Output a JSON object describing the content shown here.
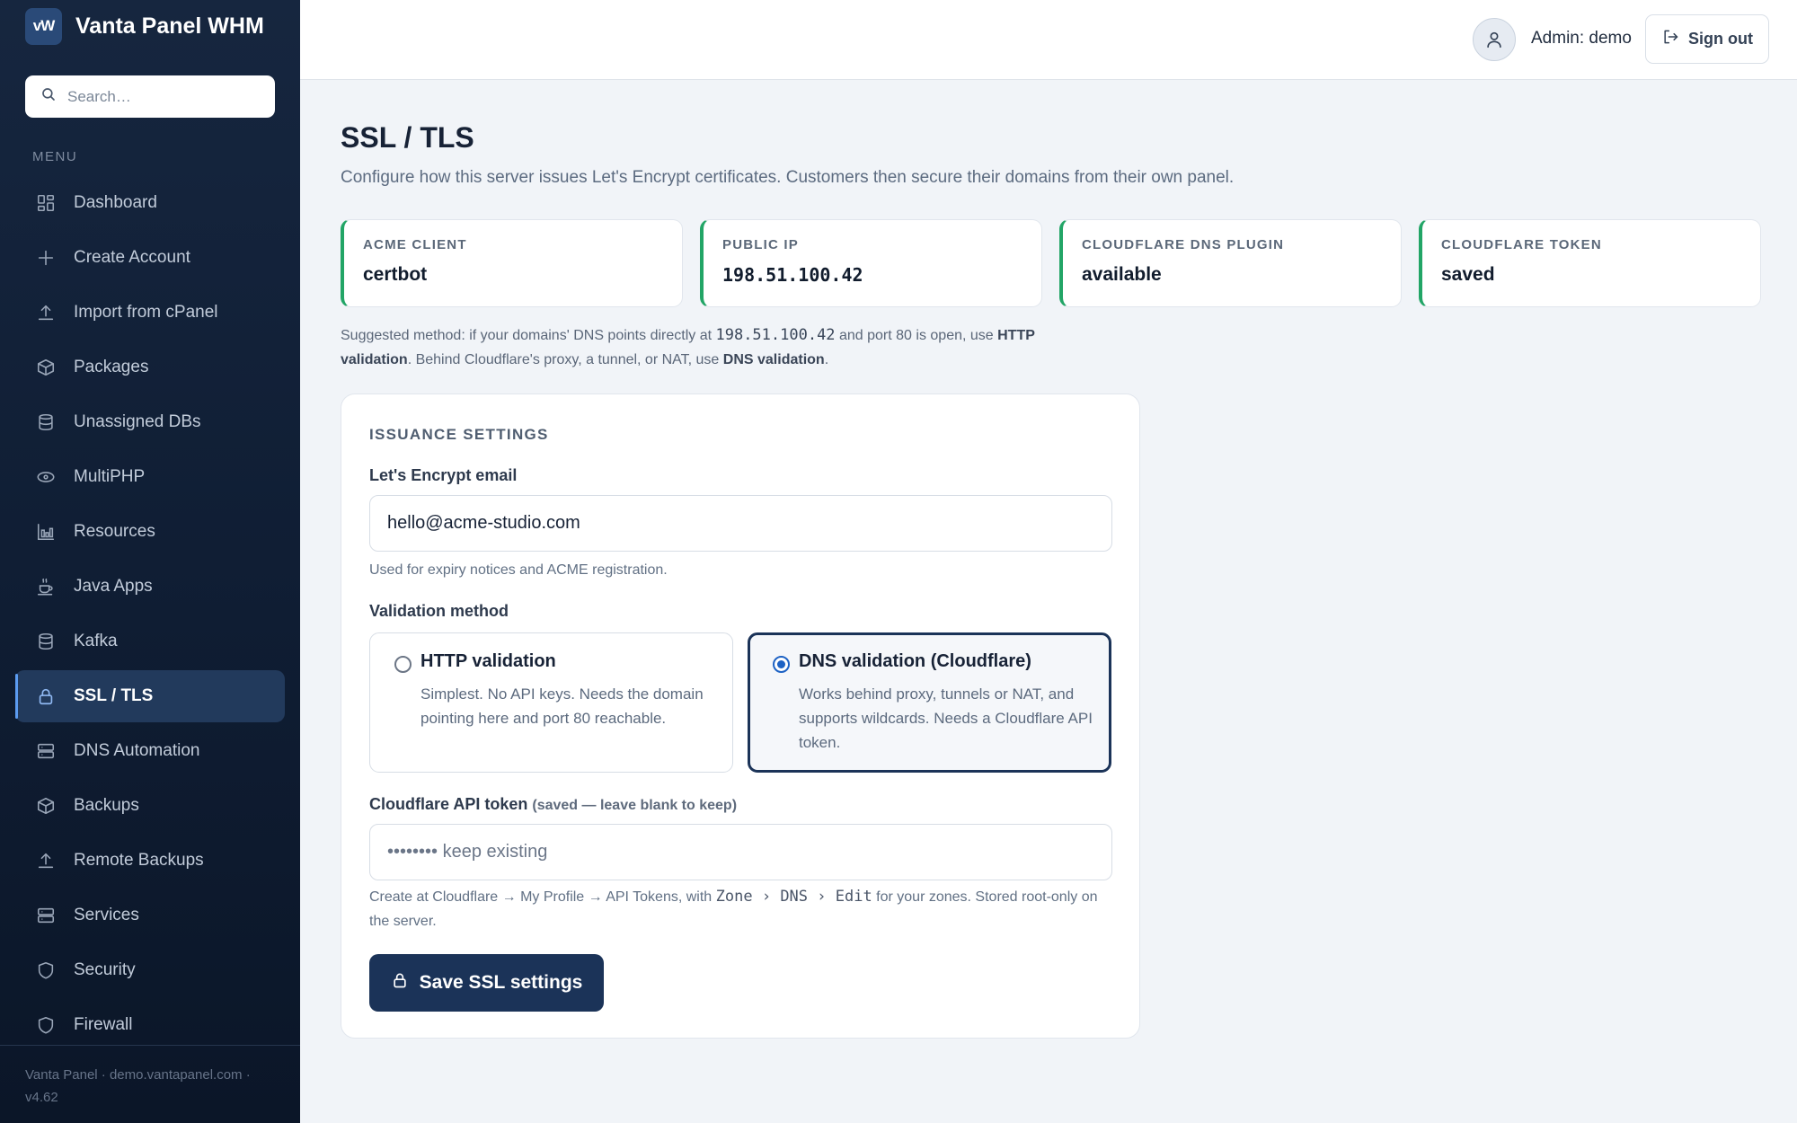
{
  "app": {
    "logo_text": "vW",
    "name": "Vanta Panel WHM"
  },
  "sidebar": {
    "search_placeholder": "Search…",
    "menu_heading": "MENU",
    "items": [
      {
        "label": "Dashboard",
        "icon": "dashboard-icon"
      },
      {
        "label": "Create Account",
        "icon": "plus-icon"
      },
      {
        "label": "Import from cPanel",
        "icon": "upload-icon"
      },
      {
        "label": "Packages",
        "icon": "box-icon"
      },
      {
        "label": "Unassigned DBs",
        "icon": "database-icon"
      },
      {
        "label": "MultiPHP",
        "icon": "php-icon"
      },
      {
        "label": "Resources",
        "icon": "bar-chart-icon"
      },
      {
        "label": "Java Apps",
        "icon": "coffee-icon"
      },
      {
        "label": "Kafka",
        "icon": "database-icon"
      },
      {
        "label": "SSL / TLS",
        "icon": "lock-icon",
        "active": true
      },
      {
        "label": "DNS Automation",
        "icon": "server-icon"
      },
      {
        "label": "Backups",
        "icon": "box-icon"
      },
      {
        "label": "Remote Backups",
        "icon": "upload-icon"
      },
      {
        "label": "Services",
        "icon": "server-icon"
      },
      {
        "label": "Security",
        "icon": "shield-icon"
      },
      {
        "label": "Firewall",
        "icon": "shield-icon"
      }
    ],
    "footer": "Vanta Panel · demo.vantapanel.com · v4.62"
  },
  "header": {
    "admin_label": "Admin: demo",
    "sign_out": "Sign out"
  },
  "page": {
    "title": "SSL / TLS",
    "subtitle": "Configure how this server issues Let's Encrypt certificates. Customers then secure their domains from their own panel.",
    "stats": [
      {
        "label": "ACME CLIENT",
        "value": "certbot"
      },
      {
        "label": "PUBLIC IP",
        "value": "198.51.100.42"
      },
      {
        "label": "CLOUDFLARE DNS PLUGIN",
        "value": "available"
      },
      {
        "label": "CLOUDFLARE TOKEN",
        "value": "saved"
      }
    ],
    "note": {
      "p1": "Suggested method: if your domains' DNS points directly at ",
      "ip": "198.51.100.42",
      "p2": " and port 80 is open, use ",
      "http_bold": "HTTP validation",
      "p3": ". Behind Cloudflare's proxy, a tunnel, or NAT, use ",
      "dns_bold": "DNS validation",
      "p4": "."
    }
  },
  "settings": {
    "title": "ISSUANCE SETTINGS",
    "email_label": "Let's Encrypt email",
    "email_value": "hello@acme-studio.com",
    "email_help": "Used for expiry notices and ACME registration.",
    "method_label": "Validation method",
    "methods": [
      {
        "title": "HTTP validation",
        "desc": "Simplest. No API keys. Needs the domain pointing here and port 80 reachable.",
        "selected": false
      },
      {
        "title": "DNS validation (Cloudflare)",
        "desc": "Works behind proxy, tunnels or NAT, and supports wildcards. Needs a Cloudflare API token.",
        "selected": true
      }
    ],
    "token_label": "Cloudflare API token",
    "token_hint": "(saved — leave blank to keep)",
    "token_placeholder": "•••••••• keep existing",
    "token_help": {
      "p1": "Create at Cloudflare → My Profile → API Tokens, with ",
      "perm1": "Zone",
      "sep1": " › ",
      "perm2": "DNS",
      "sep2": " › ",
      "perm3": "Edit",
      "p2": " for your zones. Stored root-only on the server."
    },
    "save_label": "Save SSL settings"
  },
  "colors": {
    "sidebar_bg": "#132238",
    "accent": "#1b3358",
    "success": "#22a566",
    "radio_selected": "#1d62c4"
  }
}
